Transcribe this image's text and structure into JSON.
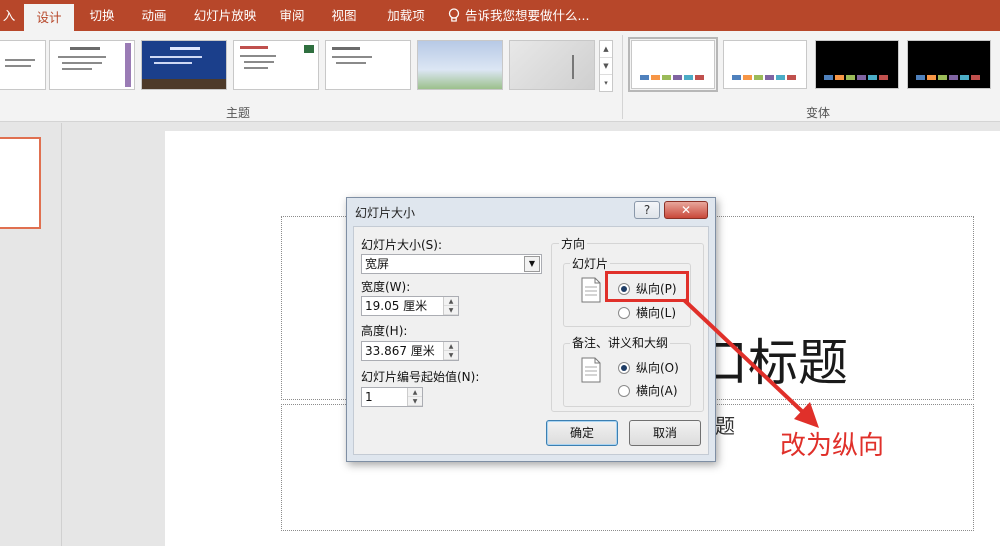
{
  "ribbon": {
    "tabs": [
      "入",
      "设计",
      "切换",
      "动画",
      "幻灯片放映",
      "审阅",
      "视图",
      "加载项"
    ],
    "active_tab": "设计",
    "tell_me": "告诉我您想要做什么...",
    "groups": {
      "themes": "主题",
      "variants": "变体"
    }
  },
  "slide": {
    "title_text": "口标题",
    "subtitle_text": "题"
  },
  "dialog": {
    "title": "幻灯片大小",
    "help_label": "?",
    "close_label": "✕",
    "size_label": "幻灯片大小(S):",
    "size_value": "宽屏",
    "width_label": "宽度(W):",
    "width_value": "19.05 厘米",
    "height_label": "高度(H):",
    "height_value": "33.867 厘米",
    "start_label": "幻灯片编号起始值(N):",
    "start_value": "1",
    "orientation_label": "方向",
    "slides_label": "幻灯片",
    "slides_portrait": "纵向(P)",
    "slides_landscape": "横向(L)",
    "notes_label": "备注、讲义和大纲",
    "notes_portrait": "纵向(O)",
    "notes_landscape": "横向(A)",
    "ok_label": "确定",
    "cancel_label": "取消"
  },
  "annotation": {
    "text": "改为纵向",
    "color": "#e0302a"
  },
  "colors": {
    "ribbon_accent": "#b7472a",
    "variant_bars": [
      "#4f81bd",
      "#f79646",
      "#9bbb59",
      "#8064a2",
      "#4bacc6",
      "#c0504d"
    ]
  }
}
